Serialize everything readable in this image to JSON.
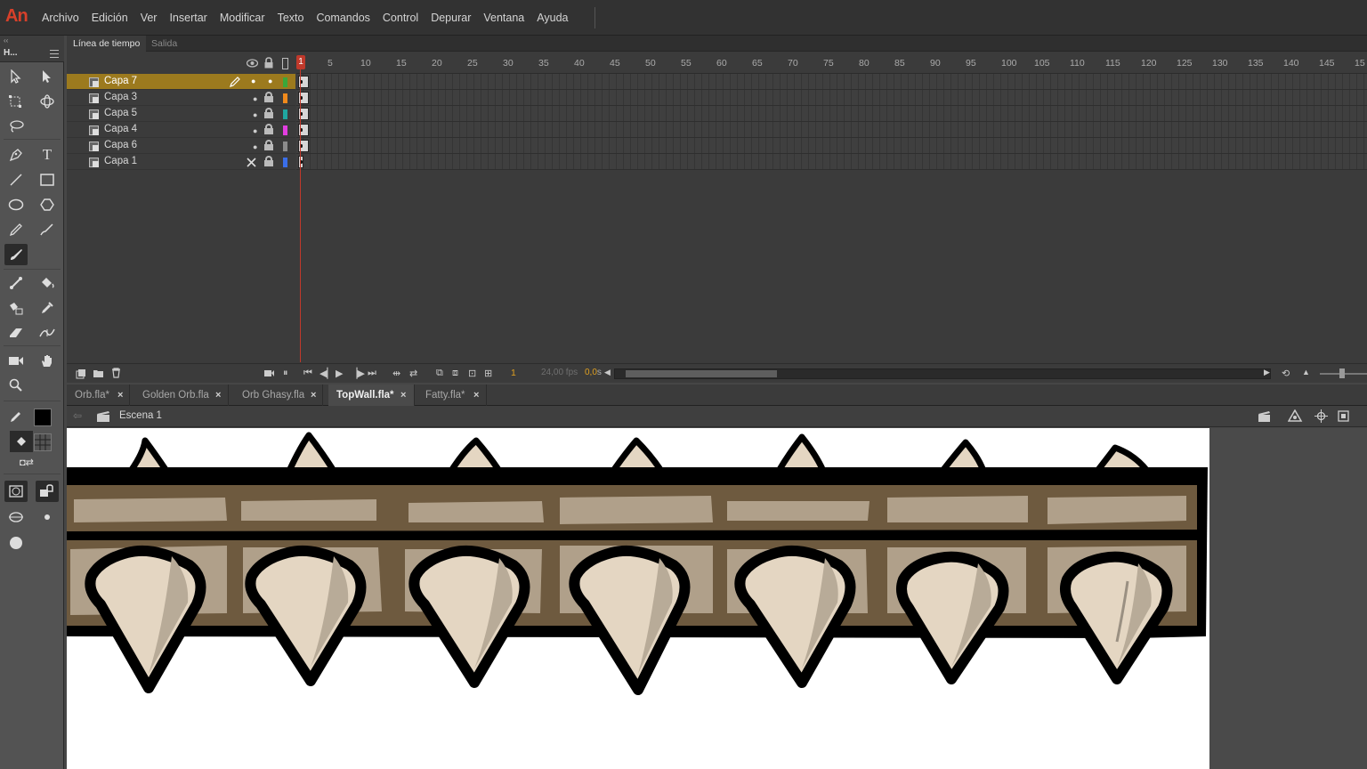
{
  "app": {
    "logo": "An"
  },
  "menu": [
    "Archivo",
    "Edición",
    "Ver",
    "Insertar",
    "Modificar",
    "Texto",
    "Comandos",
    "Control",
    "Depurar",
    "Ventana",
    "Ayuda"
  ],
  "tools_panel": {
    "tab": "H...",
    "collapse": "‹‹"
  },
  "timeline": {
    "tabs": [
      "Línea de tiempo",
      "Salida"
    ],
    "ruler": [
      "1",
      "5",
      "10",
      "15",
      "20",
      "25",
      "30",
      "35",
      "40",
      "45",
      "50",
      "55",
      "60",
      "65",
      "70",
      "75",
      "80",
      "85",
      "90",
      "95",
      "100",
      "105",
      "110",
      "115",
      "120",
      "125",
      "130",
      "135",
      "140",
      "145",
      "15"
    ],
    "layers": [
      {
        "name": "Capa 7",
        "color": "#3aa83a",
        "active": true
      },
      {
        "name": "Capa 3",
        "color": "#f08a1c"
      },
      {
        "name": "Capa 5",
        "color": "#1fa7a0"
      },
      {
        "name": "Capa 4",
        "color": "#e23ee0"
      },
      {
        "name": "Capa 6",
        "color": "#8c8c8c"
      },
      {
        "name": "Capa 1",
        "color": "#3a6ee8"
      }
    ],
    "current_frame": "1",
    "fps": "24,00 fps",
    "seconds_value": "0,0",
    "seconds_unit": "s"
  },
  "doc_tabs": [
    {
      "label": "Orb.fla*",
      "active": false
    },
    {
      "label": "Golden Orb.fla",
      "active": false
    },
    {
      "label": "Orb Ghasy.fla",
      "active": false
    },
    {
      "label": "TopWall.fla*",
      "active": true
    },
    {
      "label": "Fatty.fla*",
      "active": false
    }
  ],
  "editbar": {
    "scene": "Escena 1"
  },
  "colors": {
    "stroke": "#000000",
    "wall_brown": "#6e5a3f",
    "brick": "#b0a08a",
    "spike": "#e4d6c2",
    "spike_shade": "#b8ab98",
    "accent_playhead": "#c0392b"
  }
}
